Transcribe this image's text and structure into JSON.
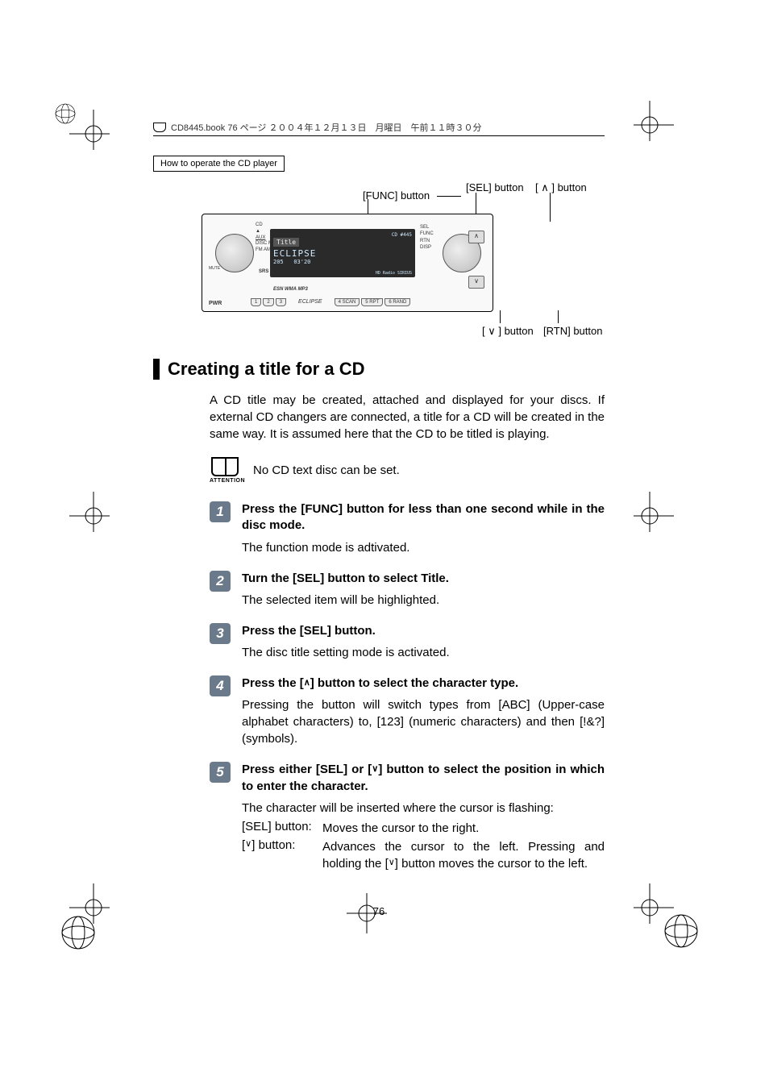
{
  "header": {
    "runner": "CD8445.book  76 ページ  ２００４年１２月１３日　月曜日　午前１１時３０分"
  },
  "section_tab": "How to operate the CD player",
  "fig_labels": {
    "func": "[FUNC] button",
    "sel": "[SEL] button",
    "up": "[ ∧ ] button",
    "down": "[ ∨ ] button",
    "rtn": "[RTN] button"
  },
  "device": {
    "model": "CD #445",
    "display_title": "Title",
    "display_brand": "ECLIPSE",
    "display_num": "205",
    "display_time": "03'20",
    "hd": "HD Radio",
    "sirius": "SIRIUS",
    "esn": "ESN WMA MP3",
    "left_labels": [
      "CD",
      "▲",
      "AUX",
      "DISC MS",
      "FM AM"
    ],
    "left_small": [
      "MUTE",
      "SRS"
    ],
    "pwr": "PWR",
    "right_labels": [
      "SEL",
      "FUNC",
      "RTN",
      "DISP"
    ],
    "up_sym": "∧",
    "down_sym": "∨",
    "bottom_keys": [
      "1",
      "2",
      "3",
      "4 SCAN",
      "5 RPT",
      "6 RAND"
    ],
    "bottom_brand": "ECLIPSE"
  },
  "heading": "Creating a title for a CD",
  "intro": "A CD title may be created, attached and displayed for your discs. If external CD changers are connected, a title for a CD will be created in the same way. It is assumed here that the CD to be titled is playing.",
  "attention": {
    "label": "ATTENTION",
    "text": "No CD text disc can be set."
  },
  "steps": [
    {
      "num": "1",
      "title": "Press the [FUNC] button for less than one second while in the disc mode.",
      "text": "The function mode is adtivated."
    },
    {
      "num": "2",
      "title": "Turn the [SEL] button to select Title.",
      "text": "The selected item will be highlighted."
    },
    {
      "num": "3",
      "title": "Press the [SEL] button.",
      "text": "The disc title setting mode is activated."
    },
    {
      "num": "4",
      "title_pre": "Press the [",
      "title_sym": "∧",
      "title_post": "] button to select the character type.",
      "text": "Pressing the button will switch types from [ABC] (Upper-case alphabet characters) to, [123] (numeric characters) and then [!&?] (symbols)."
    },
    {
      "num": "5",
      "title_pre": "Press either [SEL] or [",
      "title_sym": "∨",
      "title_post": "] button to select the position in which to enter the character.",
      "text": "The character will be inserted where the cursor is flashing:",
      "rows": [
        {
          "label": "[SEL] button:",
          "text": "Moves the cursor to the right."
        },
        {
          "label_pre": "[",
          "label_sym": "∨",
          "label_post": "] button:",
          "text_pre": "Advances the cursor to the left. Pressing and holding the [",
          "text_sym": "∨",
          "text_post": "] button moves the cursor to the left."
        }
      ]
    }
  ],
  "page_num": "76"
}
